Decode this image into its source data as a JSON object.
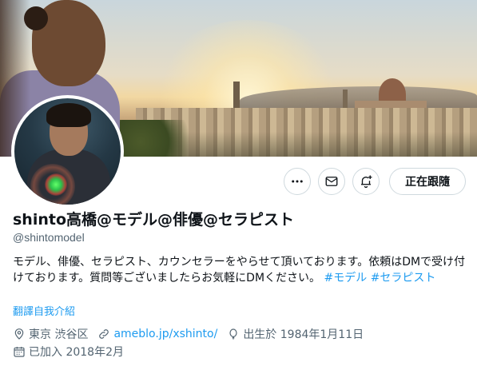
{
  "profile": {
    "display_name": "shinto高橋@モデル@俳優@セラピスト",
    "handle": "@shintomodel",
    "bio_text": "モデル、俳優、セラピスト、カウンセラーをやらせて頂いております。依頼はDMで受け付けております。質問等ございましたらお気軽にDMください。",
    "hashtag_1": "#モデル",
    "hashtag_2": "#セラピスト",
    "translate_label": "翻譯自我介紹"
  },
  "actions": {
    "more_icon": "more-dots-icon",
    "mail_icon": "envelope-icon",
    "bell_icon": "bell-plus-icon",
    "follow_label": "正在跟隨"
  },
  "meta": {
    "location": "東京 渋谷区",
    "website": "ameblo.jp/xshinto/",
    "birthday": "出生於 1984年1月11日",
    "joined": "已加入 2018年2月",
    "location_icon": "location-pin-icon",
    "link_icon": "link-icon",
    "birthday_icon": "balloon-icon",
    "calendar_icon": "calendar-icon"
  },
  "colors": {
    "accent": "#1d9bf0",
    "secondary_text": "#536471",
    "border": "#cfd9de"
  }
}
